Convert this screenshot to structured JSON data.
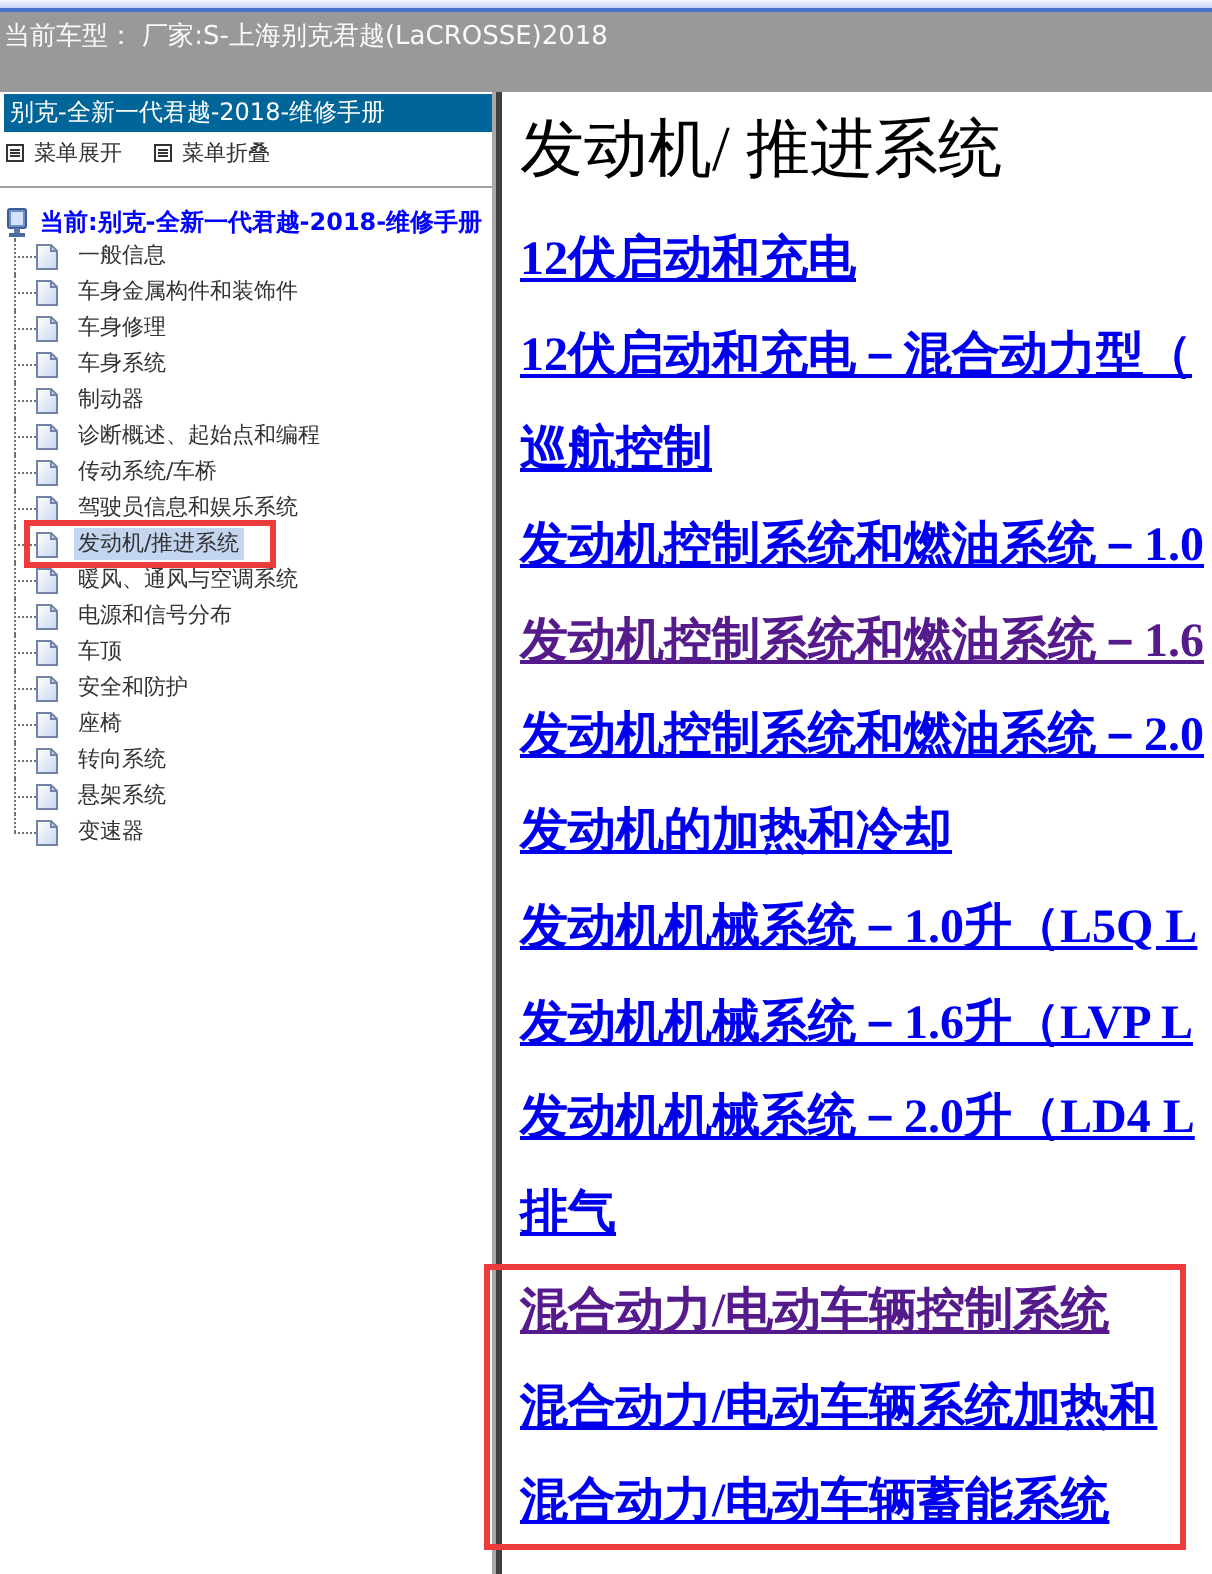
{
  "top_bar": {
    "vehicle": "当前车型： 厂家:S-上海别克君越(LaCROSSE)2018"
  },
  "sidebar": {
    "title": "别克-全新一代君越-2018-维修手册",
    "actions": [
      "菜单展开",
      "菜单折叠"
    ],
    "tree": {
      "label": "当前:别克-全新一代君越-2018-维修手册",
      "children": [
        {
          "label": "一般信息",
          "selected": false,
          "highlighted": false
        },
        {
          "label": "车身金属构件和装饰件",
          "selected": false,
          "highlighted": false
        },
        {
          "label": "车身修理",
          "selected": false,
          "highlighted": false
        },
        {
          "label": "车身系统",
          "selected": false,
          "highlighted": false
        },
        {
          "label": "制动器",
          "selected": false,
          "highlighted": false
        },
        {
          "label": "诊断概述、起始点和编程",
          "selected": false,
          "highlighted": false
        },
        {
          "label": "传动系统/车桥",
          "selected": false,
          "highlighted": false
        },
        {
          "label": "驾驶员信息和娱乐系统",
          "selected": false,
          "highlighted": false
        },
        {
          "label": "发动机/推进系统",
          "selected": true,
          "highlighted": true
        },
        {
          "label": "暖风、通风与空调系统",
          "selected": false,
          "highlighted": false
        },
        {
          "label": "电源和信号分布",
          "selected": false,
          "highlighted": false
        },
        {
          "label": "车顶",
          "selected": false,
          "highlighted": false
        },
        {
          "label": "安全和防护",
          "selected": false,
          "highlighted": false
        },
        {
          "label": "座椅",
          "selected": false,
          "highlighted": false
        },
        {
          "label": "转向系统",
          "selected": false,
          "highlighted": false
        },
        {
          "label": "悬架系统",
          "selected": false,
          "highlighted": false
        },
        {
          "label": "变速器",
          "selected": false,
          "highlighted": false
        }
      ]
    }
  },
  "content": {
    "title": "发动机/ 推进系统",
    "links": [
      {
        "label": "12伏启动和充电",
        "visited": false,
        "highlighted": false
      },
      {
        "label": "12伏启动和充电－混合动力型（",
        "visited": false,
        "highlighted": false
      },
      {
        "label": "巡航控制",
        "visited": false,
        "highlighted": false
      },
      {
        "label": "发动机控制系统和燃油系统－1.0",
        "visited": false,
        "highlighted": false
      },
      {
        "label": "发动机控制系统和燃油系统－1.6",
        "visited": true,
        "highlighted": false
      },
      {
        "label": "发动机控制系统和燃油系统－2.0",
        "visited": false,
        "highlighted": false
      },
      {
        "label": "发动机的加热和冷却",
        "visited": false,
        "highlighted": false
      },
      {
        "label": "发动机机械系统－1.0升（L5Q L",
        "visited": false,
        "highlighted": false
      },
      {
        "label": "发动机机械系统－1.6升（LVP L",
        "visited": false,
        "highlighted": false
      },
      {
        "label": "发动机机械系统－2.0升（LD4 L",
        "visited": false,
        "highlighted": false
      },
      {
        "label": "排气",
        "visited": false,
        "highlighted": false
      },
      {
        "label": "混合动力/电动车辆控制系统",
        "visited": true,
        "highlighted": true
      },
      {
        "label": "混合动力/电动车辆系统加热和",
        "visited": false,
        "highlighted": true
      },
      {
        "label": "混合动力/电动车辆蓄能系统",
        "visited": false,
        "highlighted": true
      }
    ]
  }
}
